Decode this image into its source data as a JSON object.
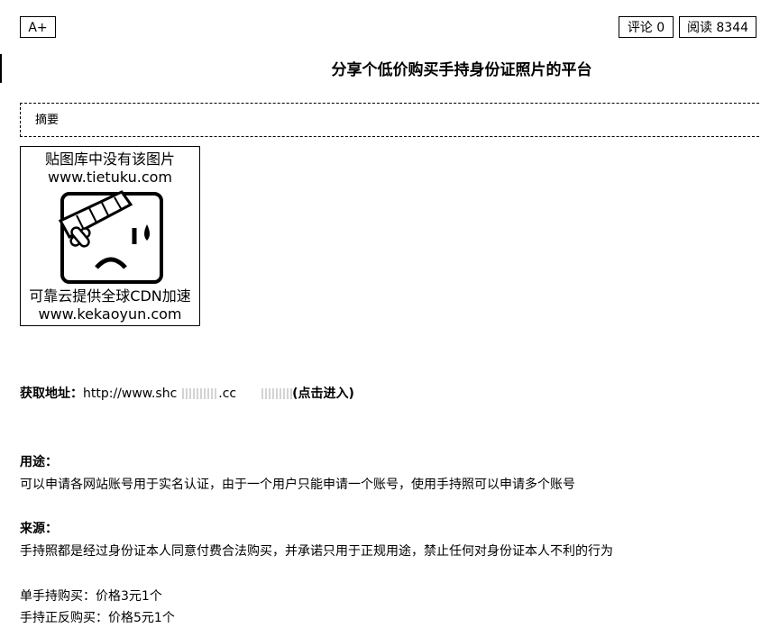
{
  "toolbar": {
    "font_size_label": "A+",
    "comment_label": "评论 0",
    "read_label": "阅读 8344"
  },
  "article": {
    "title": "分享个低价购买手持身份证照片的平台",
    "summary_label": "摘要"
  },
  "image_placeholder": {
    "line1": "贴图库中没有该图片",
    "line2": "www.tietuku.com",
    "line3": "可靠云提供全球CDN加速",
    "line4": "www.kekaoyun.com",
    "icon": "sad-face-bandage-icon"
  },
  "link": {
    "label": "获取地址：",
    "url_part1": "http://www.shc",
    "url_part2": ".cc",
    "suffix": "(点击进入)"
  },
  "usage": {
    "heading": "用途：",
    "text": "可以申请各网站账号用于实名认证，由于一个用户只能申请一个账号，使用手持照可以申请多个账号"
  },
  "source": {
    "heading": "来源：",
    "text": "手持照都是经过身份证本人同意付费合法购买，并承诺只用于正规用途，禁止任何对身份证本人不利的行为"
  },
  "prices": {
    "single": "单手持购买：价格3元1个",
    "double": "手持正反购买：价格5元1个"
  }
}
